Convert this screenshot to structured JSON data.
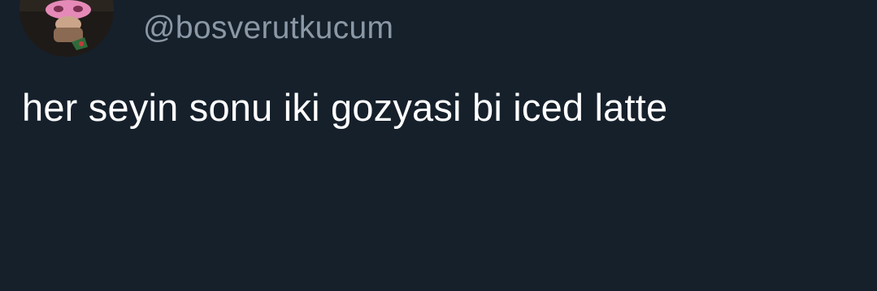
{
  "tweet": {
    "author": {
      "handle": "@bosverutkucum",
      "avatar_icon": "profile-photo"
    },
    "text": "her seyin sonu iki gozyasi bi iced latte"
  },
  "colors": {
    "background": "#15202b",
    "handle": "#8b98a5",
    "text": "#ffffff"
  }
}
